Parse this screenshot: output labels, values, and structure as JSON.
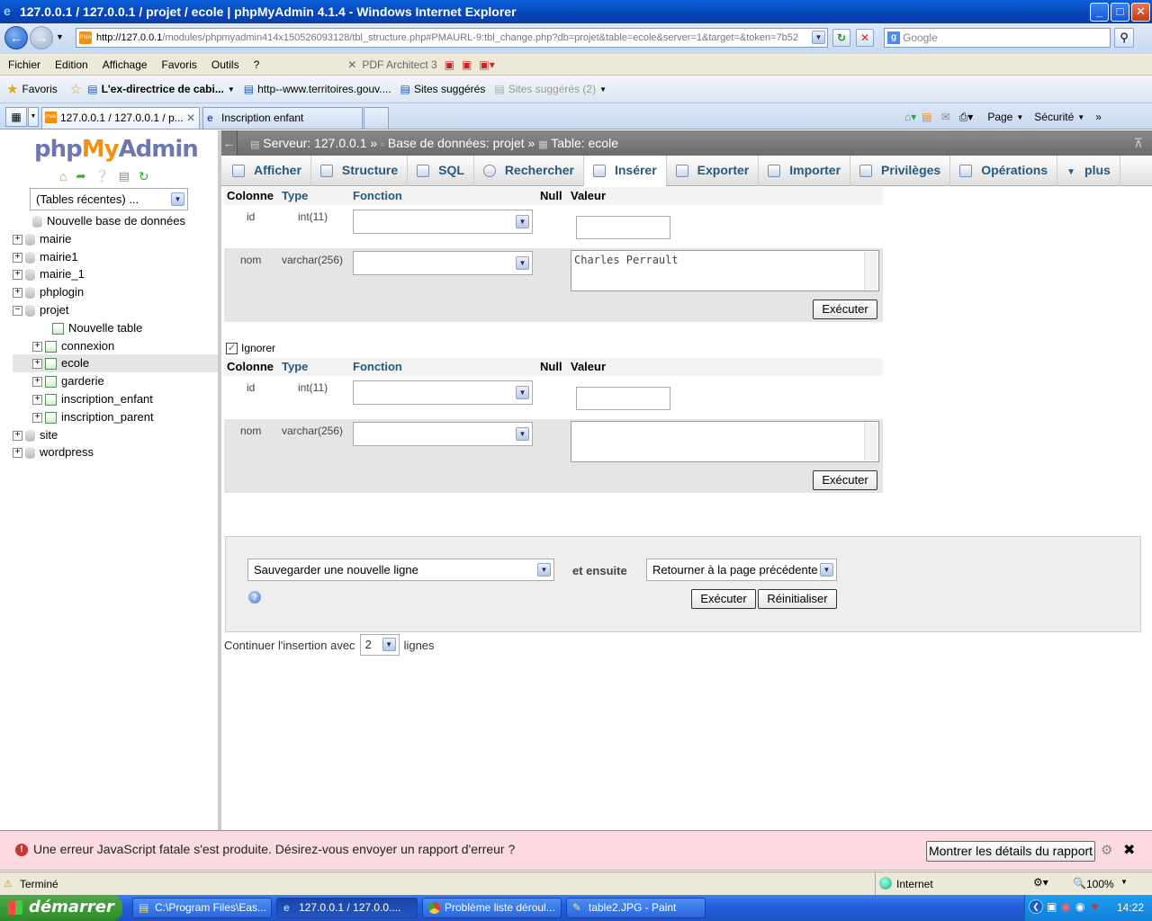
{
  "window": {
    "title": "127.0.0.1 / 127.0.0.1 / projet / ecole | phpMyAdmin 4.1.4 - Windows Internet Explorer",
    "buttons": {
      "minimize": "_",
      "maximize": "□",
      "close": "✕"
    }
  },
  "browser": {
    "url_host": "http://127.0.0.1",
    "url_rest": "/modules/phpmyadmin414x150526093128/tbl_structure.php#PMAURL-9:tbl_change.php?db=projet&table=ecole&server=1&target=&token=7b52",
    "search_placeholder": "Google",
    "menu": [
      "Fichier",
      "Edition",
      "Affichage",
      "Favoris",
      "Outils",
      "?"
    ],
    "pdf_addon": "PDF Architect 3",
    "favorites": {
      "label": "Favoris",
      "items": [
        "L'ex-directrice de cabi...",
        "http--www.territoires.gouv....",
        "Sites suggérés",
        "Sites suggérés (2)"
      ]
    },
    "tabs": [
      {
        "label": "127.0.0.1 / 127.0.0.1 / p...",
        "active": true
      },
      {
        "label": "Inscription enfant",
        "active": false
      }
    ],
    "commandbar": {
      "page": "Page",
      "securite": "Sécurité"
    }
  },
  "pma": {
    "logo": {
      "php": "php",
      "my": "My",
      "admin": "Admin"
    },
    "recent_tables": "(Tables récentes) ...",
    "tree": [
      {
        "label": "Nouvelle base de données",
        "level": 0,
        "kind": "new"
      },
      {
        "label": "mairie",
        "level": 0,
        "kind": "db"
      },
      {
        "label": "mairie1",
        "level": 0,
        "kind": "db"
      },
      {
        "label": "mairie_1",
        "level": 0,
        "kind": "db"
      },
      {
        "label": "phplogin",
        "level": 0,
        "kind": "db"
      },
      {
        "label": "projet",
        "level": 0,
        "kind": "db",
        "expanded": true
      },
      {
        "label": "Nouvelle table",
        "level": 1,
        "kind": "newtable"
      },
      {
        "label": "connexion",
        "level": 1,
        "kind": "table"
      },
      {
        "label": "ecole",
        "level": 1,
        "kind": "table",
        "selected": true
      },
      {
        "label": "garderie",
        "level": 1,
        "kind": "table"
      },
      {
        "label": "inscription_enfant",
        "level": 1,
        "kind": "table"
      },
      {
        "label": "inscription_parent",
        "level": 1,
        "kind": "table"
      },
      {
        "label": "site",
        "level": 0,
        "kind": "db"
      },
      {
        "label": "wordpress",
        "level": 0,
        "kind": "db"
      }
    ],
    "breadcrumb": {
      "server": "Serveur: 127.0.0.1",
      "sep": "»",
      "database": "Base de données: projet",
      "table": "Table: ecole"
    },
    "tabs": [
      "Afficher",
      "Structure",
      "SQL",
      "Rechercher",
      "Insérer",
      "Exporter",
      "Importer",
      "Privilèges",
      "Opérations",
      "plus"
    ],
    "active_tab": "Insérer",
    "headers": {
      "colonne": "Colonne",
      "type": "Type",
      "fonction": "Fonction",
      "null": "Null",
      "valeur": "Valeur"
    },
    "form1": {
      "rows": [
        {
          "name": "id",
          "type": "int(11)",
          "value": ""
        },
        {
          "name": "nom",
          "type": "varchar(256)",
          "value": "Charles Perrault"
        }
      ],
      "execute": "Exécuter"
    },
    "ignore_label": "Ignorer",
    "form2": {
      "rows": [
        {
          "name": "id",
          "type": "int(11)",
          "value": ""
        },
        {
          "name": "nom",
          "type": "varchar(256)",
          "value": ""
        }
      ],
      "execute": "Exécuter"
    },
    "actions": {
      "save_option": "Sauvegarder une nouvelle ligne",
      "then_label": "et ensuite",
      "after_option": "Retourner à la page précédente",
      "execute": "Exécuter",
      "reset": "Réinitialiser"
    },
    "continue": {
      "prefix": "Continuer l'insertion avec",
      "count": "2",
      "suffix": "lignes"
    },
    "error": {
      "message": "Une erreur JavaScript fatale s'est produite. Désirez-vous envoyer un rapport d'erreur ?",
      "details_button": "Montrer les détails du rapport"
    }
  },
  "status": {
    "left": "Terminé",
    "zone": "Internet",
    "zoom": "100%"
  },
  "taskbar": {
    "start": "démarrer",
    "tasks": [
      {
        "label": "C:\\Program Files\\Eas...",
        "active": false
      },
      {
        "label": "127.0.0.1 / 127.0.0....",
        "active": true
      },
      {
        "label": "Problème liste déroul...",
        "active": false
      },
      {
        "label": "table2.JPG - Paint",
        "active": false
      }
    ],
    "clock": "14:22"
  }
}
